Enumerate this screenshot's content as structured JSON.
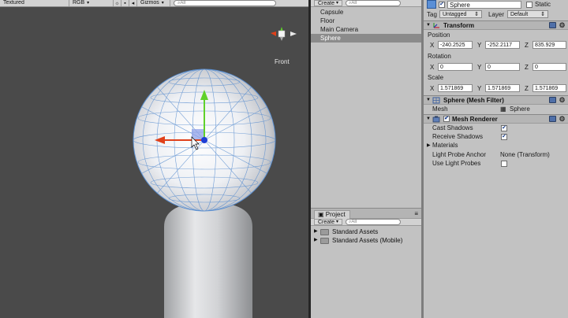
{
  "scene": {
    "toolbar": {
      "render_mode": "Textured",
      "color_mode": "RGB",
      "gizmos_label": "Gizmos",
      "search_placeholder": "All"
    },
    "view_label": "Front"
  },
  "hierarchy": {
    "create_label": "Create",
    "search_placeholder": "All",
    "items": [
      {
        "label": "Capsule",
        "selected": false
      },
      {
        "label": "Floor",
        "selected": false
      },
      {
        "label": "Main Camera",
        "selected": false
      },
      {
        "label": "Sphere",
        "selected": true
      }
    ]
  },
  "project": {
    "tab_label": "Project",
    "create_label": "Create",
    "search_placeholder": "All",
    "items": [
      {
        "label": "Standard Assets"
      },
      {
        "label": "Standard Assets (Mobile)"
      }
    ]
  },
  "inspector": {
    "object_name": "Sphere",
    "static_label": "Static",
    "tag_label": "Tag",
    "tag_value": "Untagged",
    "layer_label": "Layer",
    "layer_value": "Default",
    "transform": {
      "title": "Transform",
      "position_label": "Position",
      "position": {
        "x": "-240.2525",
        "y": "-252.2117",
        "z": "835.929"
      },
      "rotation_label": "Rotation",
      "rotation": {
        "x": "0",
        "y": "0",
        "z": "0"
      },
      "scale_label": "Scale",
      "scale": {
        "x": "1.571869",
        "y": "1.571869",
        "z": "1.571869"
      }
    },
    "mesh_filter": {
      "title": "Sphere (Mesh Filter)",
      "mesh_label": "Mesh",
      "mesh_value": "Sphere"
    },
    "mesh_renderer": {
      "title": "Mesh Renderer",
      "cast_shadows_label": "Cast Shadows",
      "receive_shadows_label": "Receive Shadows",
      "materials_label": "Materials",
      "light_probe_anchor_label": "Light Probe Anchor",
      "light_probe_anchor_value": "None (Transform)",
      "use_light_probes_label": "Use Light Probes"
    }
  },
  "axis_labels": {
    "x": "X",
    "y": "Y",
    "z": "Z"
  },
  "icons": {
    "search": "search-icon",
    "gear": "gear-icon",
    "help": "help-book-icon",
    "folder": "folder-icon"
  },
  "colors": {
    "x_axis": "#e0401a",
    "y_axis": "#5fd12a",
    "z_axis": "#1f3fd6",
    "wire": "#5b8fd0",
    "selection": "#8b8b8b"
  }
}
